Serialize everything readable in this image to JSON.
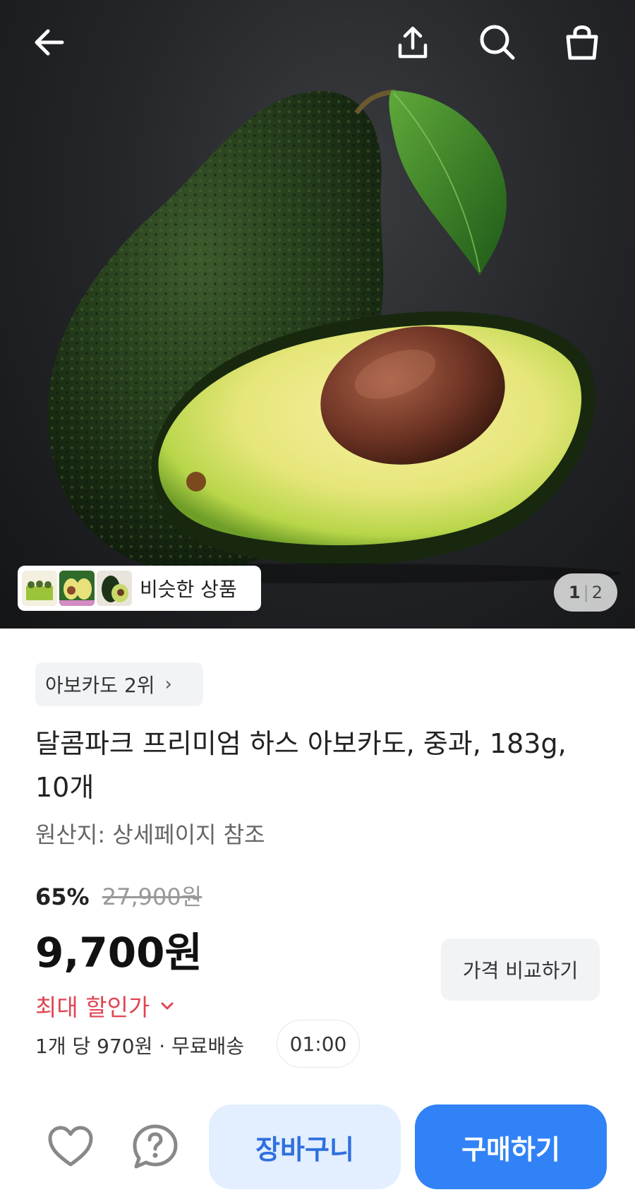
{
  "header": {
    "icons": [
      "back-arrow-icon",
      "share-icon",
      "search-icon",
      "shopping-bag-icon"
    ]
  },
  "hero": {
    "similar_label": "비슷한 상품",
    "pager_current": "1",
    "pager_separator": "|",
    "pager_total": "2"
  },
  "product": {
    "rank_label": "아보카도 2위",
    "title": "달콤파크 프리미엄 하스 아보카도, 중과, 183g, 10개",
    "origin": "원산지: 상세페이지 참조",
    "discount_rate": "65%",
    "original_price": "27,900원",
    "price": "9,700원",
    "compare_label": "가격 비교하기",
    "max_discount_label": "최대 할인가",
    "unit_info": "1개 당 970원 · 무료배송",
    "timer": "01:00"
  },
  "bottom": {
    "cart_label": "장바구니",
    "buy_label": "구매하기"
  },
  "colors": {
    "primary": "#3182f6",
    "primary_light": "#e3effe",
    "discount_red": "#e04453"
  }
}
